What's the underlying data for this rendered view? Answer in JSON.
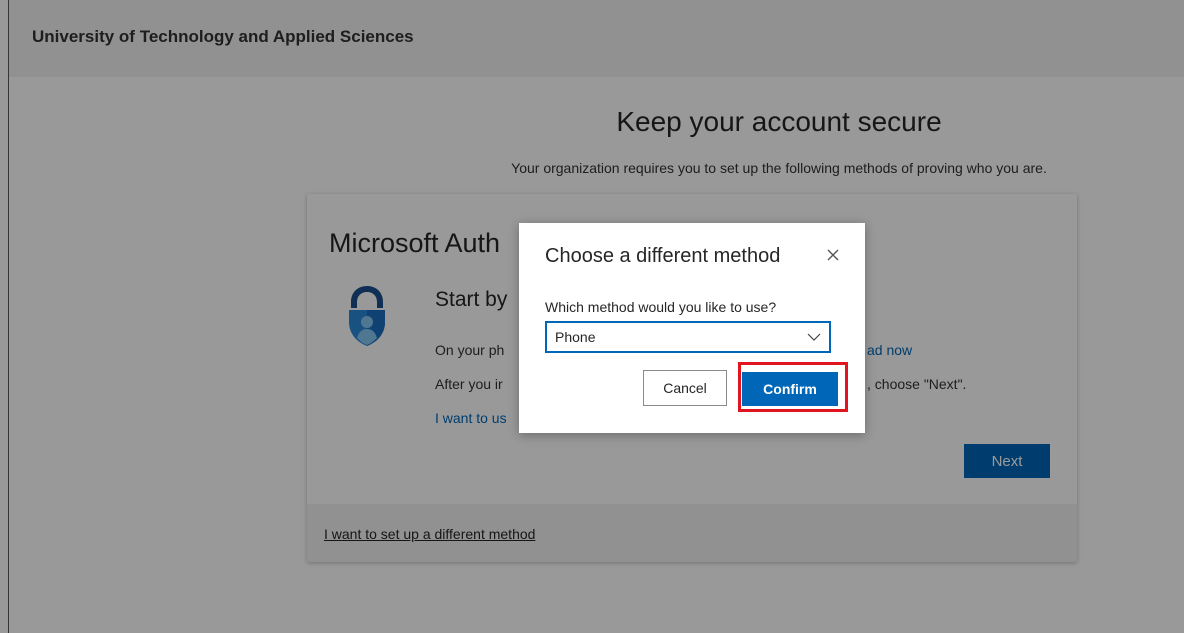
{
  "header": {
    "org_name": "University of Technology and Applied Sciences"
  },
  "main": {
    "title": "Keep your account secure",
    "subtitle": "Your organization requires you to set up the following methods of proving who you are."
  },
  "card": {
    "title": "Microsoft Auth",
    "step_title": "Start by",
    "line1": "On your ph",
    "line2": "After you ir",
    "link": "I want to us",
    "download_fragment": "ad now",
    "next_fragment": ", choose \"Next\".",
    "next_label": "Next",
    "footer_link": "I want to set up a different method"
  },
  "dialog": {
    "title": "Choose a different method",
    "question": "Which method would you like to use?",
    "selected_method": "Phone",
    "cancel_label": "Cancel",
    "confirm_label": "Confirm"
  },
  "colors": {
    "accent": "#0067b8",
    "highlight": "#e0151f"
  },
  "icons": [
    "microsoft-authenticator-logo-icon",
    "close-icon",
    "chevron-down-icon"
  ]
}
